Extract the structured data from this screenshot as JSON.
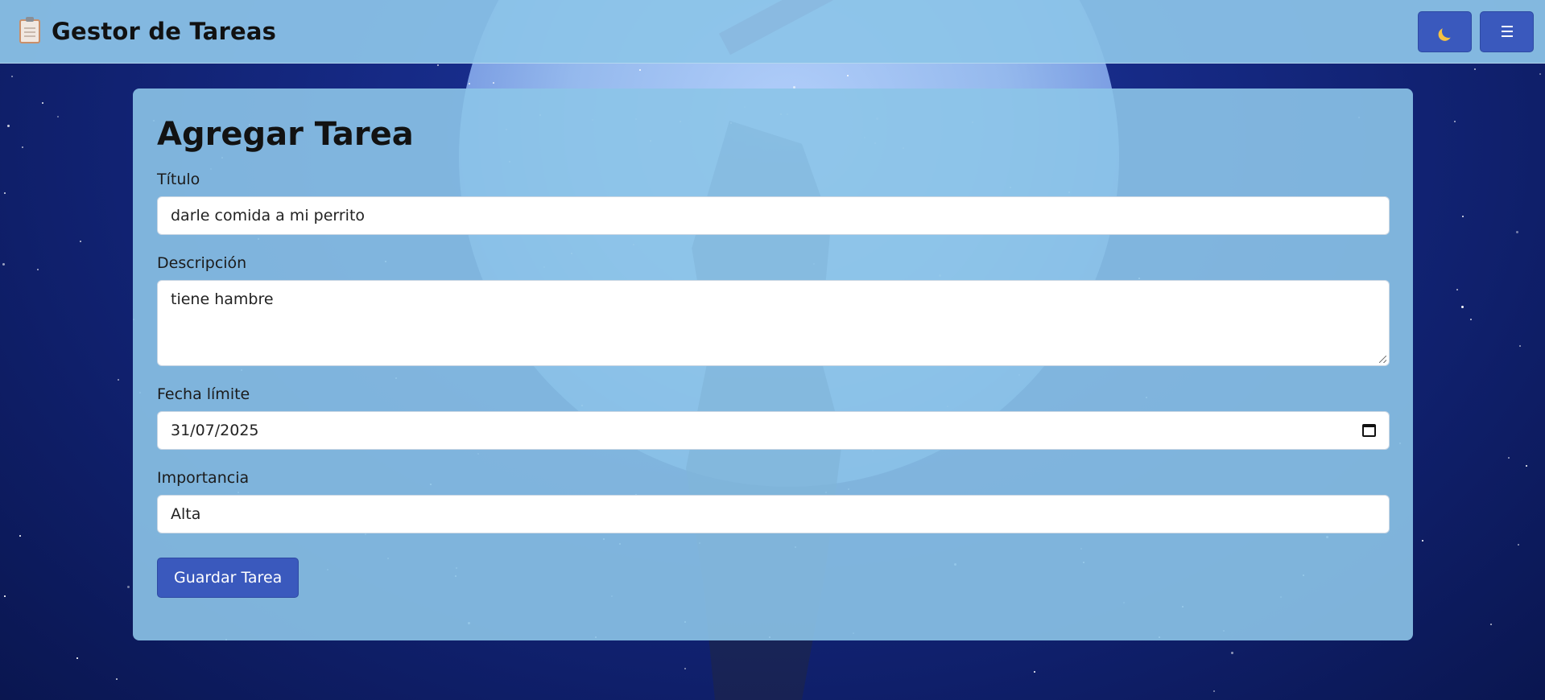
{
  "header": {
    "app_title": "Gestor de Tareas",
    "brand_icon": "clipboard-icon",
    "theme_toggle_icon": "moon-icon",
    "menu_icon": "hamburger-icon"
  },
  "form": {
    "title": "Agregar Tarea",
    "titulo": {
      "label": "Título",
      "value": "darle comida a mi perrito"
    },
    "descripcion": {
      "label": "Descripción",
      "value": "tiene hambre"
    },
    "fecha": {
      "label": "Fecha límite",
      "value": "31/07/2025"
    },
    "importancia": {
      "label": "Importancia",
      "value": "Alta"
    },
    "submit_label": "Guardar Tarea"
  },
  "colors": {
    "accent": "#3a59bd",
    "panel": "#8cc4e8",
    "background": "#162a86"
  }
}
